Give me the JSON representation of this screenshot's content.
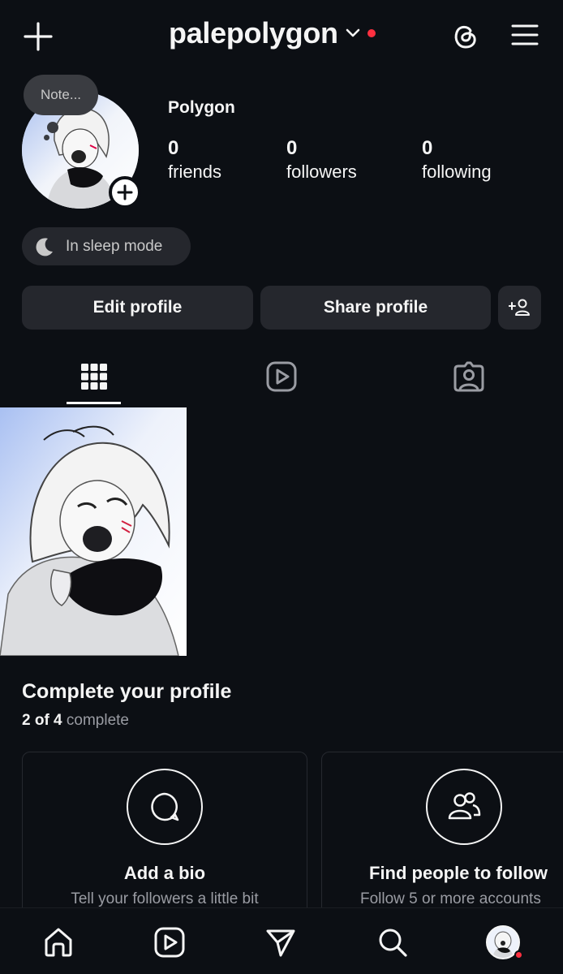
{
  "header": {
    "username": "palepolygon"
  },
  "profile": {
    "note": "Note...",
    "display_name": "Polygon",
    "stats": [
      {
        "value": "0",
        "label": "friends"
      },
      {
        "value": "0",
        "label": "followers"
      },
      {
        "value": "0",
        "label": "following"
      }
    ],
    "sleep_mode": "In sleep mode"
  },
  "actions": {
    "edit_profile": "Edit profile",
    "share_profile": "Share profile"
  },
  "tabs": [
    {
      "icon": "grid-icon",
      "selected": true
    },
    {
      "icon": "reels-icon",
      "selected": false
    },
    {
      "icon": "tagged-icon",
      "selected": false
    }
  ],
  "complete_profile": {
    "title": "Complete your profile",
    "progress_done": "2 of 4",
    "progress_word": "complete",
    "cards": [
      {
        "icon": "chat-bubble-icon",
        "title": "Add a bio",
        "text": "Tell your followers a little bit"
      },
      {
        "icon": "people-icon",
        "title": "Find people to follow",
        "text": "Follow 5 or more accounts"
      }
    ]
  },
  "bottom_nav": [
    "home-icon",
    "reels-icon",
    "send-icon",
    "search-icon",
    "profile-avatar"
  ],
  "colors": {
    "background": "#0c0f14",
    "button": "#25272d",
    "notification": "#ff3040"
  }
}
